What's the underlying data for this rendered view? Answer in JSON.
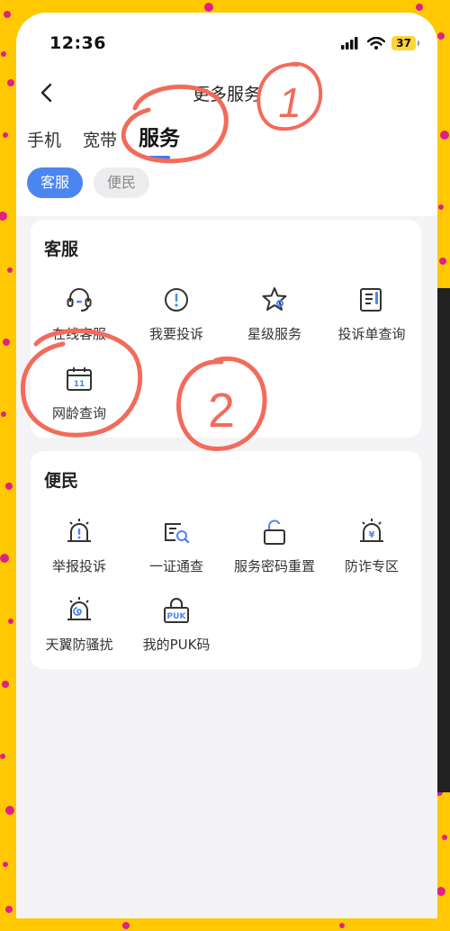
{
  "status_bar": {
    "time": "12:36",
    "battery": "37"
  },
  "nav": {
    "title": "更多服务"
  },
  "tabs": [
    {
      "label": "手机",
      "active": false
    },
    {
      "label": "宽带",
      "active": false
    },
    {
      "label": "服务",
      "active": true
    }
  ],
  "chips": [
    {
      "label": "客服",
      "active": true
    },
    {
      "label": "便民",
      "active": false
    }
  ],
  "sections": {
    "kefu": {
      "title": "客服",
      "items": [
        {
          "label": "在线客服",
          "icon": "headset-icon"
        },
        {
          "label": "我要投诉",
          "icon": "alert-circle-icon"
        },
        {
          "label": "星级服务",
          "icon": "star-icon"
        },
        {
          "label": "投诉单查询",
          "icon": "document-list-icon"
        },
        {
          "label": "网龄查询",
          "icon": "calendar-icon"
        }
      ]
    },
    "bianmin": {
      "title": "便民",
      "items": [
        {
          "label": "举报投诉",
          "icon": "alarm-alert-icon"
        },
        {
          "label": "一证通查",
          "icon": "id-search-icon"
        },
        {
          "label": "服务密码重置",
          "icon": "unlock-icon"
        },
        {
          "label": "防诈专区",
          "icon": "alarm-yuan-icon"
        },
        {
          "label": "天翼防骚扰",
          "icon": "alarm-spiral-icon"
        },
        {
          "label": "我的PUK码",
          "icon": "puk-lock-icon"
        },
        {
          "label": "PUK",
          "icon": "puk-text"
        }
      ]
    }
  },
  "annotations": {
    "one": "1",
    "two": "2"
  },
  "colors": {
    "accent": "#4B86F0",
    "annotation_red": "#F26B5B",
    "background_yellow": "#FFC800"
  }
}
